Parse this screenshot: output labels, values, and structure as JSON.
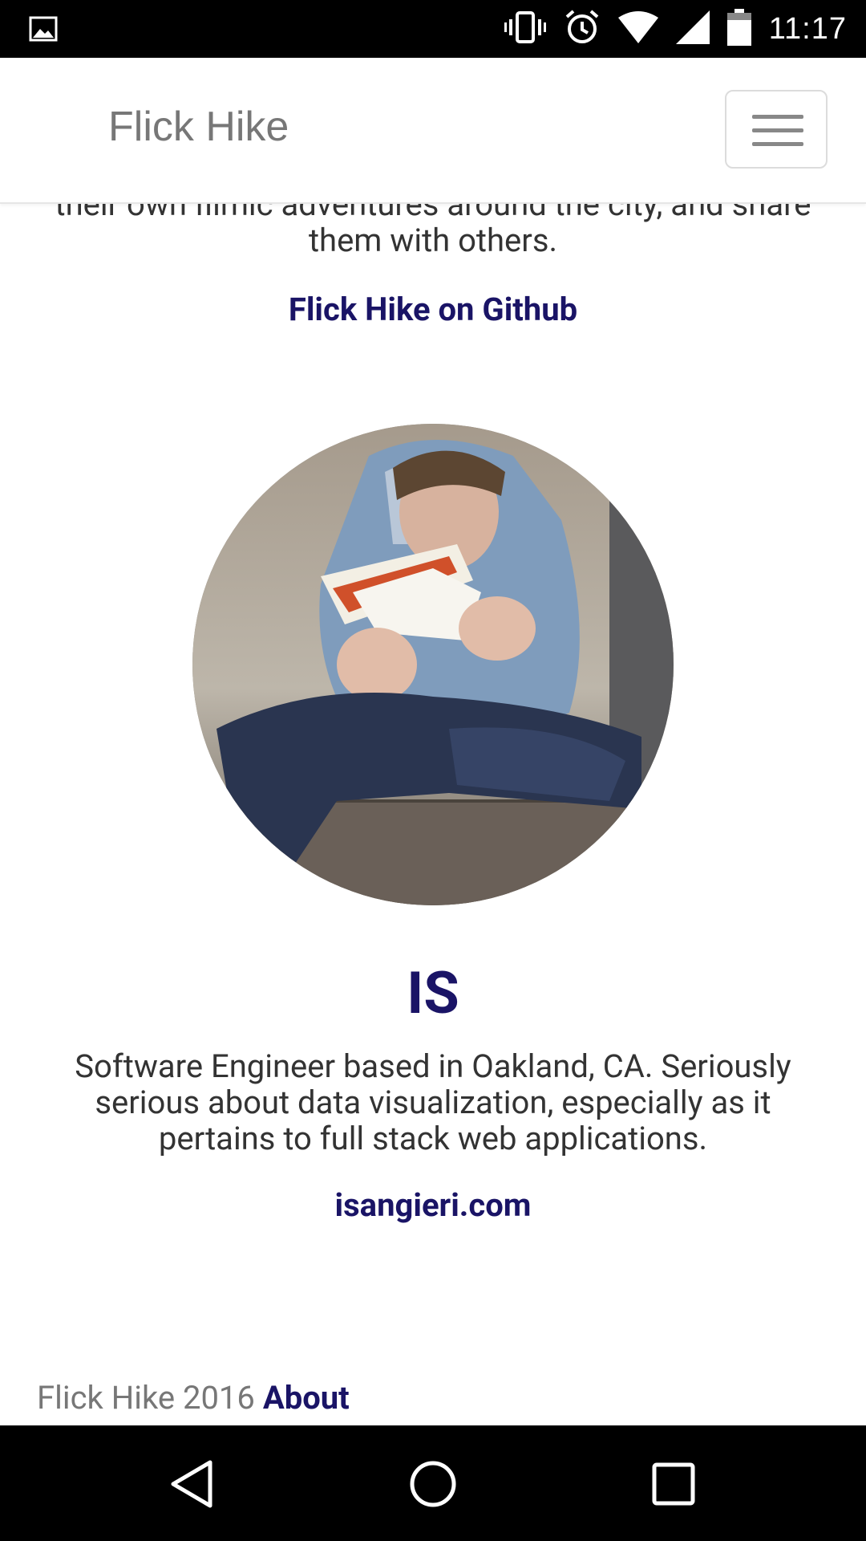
{
  "status_bar": {
    "time": "11:17",
    "icons": [
      "image-icon",
      "vibrate-icon",
      "alarm-icon",
      "wifi-icon",
      "signal-icon",
      "battery-icon"
    ]
  },
  "navbar": {
    "brand": "Flick Hike",
    "menu_icon": "hamburger-menu-icon"
  },
  "intro": {
    "text": "their own filmic adventures around the city, and share them with others.",
    "github_link": "Flick Hike on Github"
  },
  "profile": {
    "name": "IS",
    "bio": "Software Engineer based in Oakland, CA. Seriously serious about data visualization, especially as it pertains to full stack web applications.",
    "website": "isangieri.com"
  },
  "footer": {
    "text": "Flick Hike 2016",
    "about_link": "About"
  },
  "nav_bar": {
    "buttons": [
      "back-icon",
      "home-icon",
      "recents-icon"
    ]
  },
  "colors": {
    "link": "#1a1466",
    "text": "#333333",
    "muted": "#777777"
  }
}
